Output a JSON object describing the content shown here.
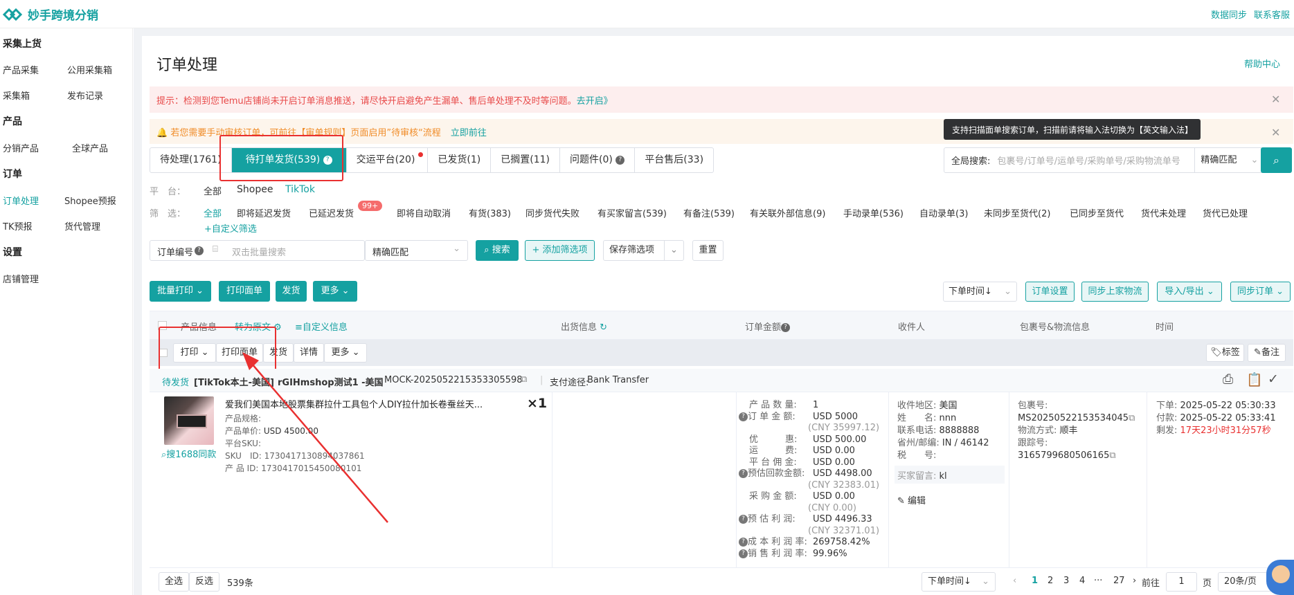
{
  "app": {
    "name": "妙手跨境分销",
    "top_links": [
      "数据同步",
      "联系客服"
    ]
  },
  "sidebar": {
    "sections": [
      {
        "title": "采集上货",
        "items": [
          "产品采集",
          "公用采集箱",
          "采集箱",
          "发布记录"
        ]
      },
      {
        "title": "产品",
        "items": [
          "分销产品",
          "全球产品"
        ]
      },
      {
        "title": "订单",
        "items": [
          "订单处理",
          "Shopee预报",
          "TK预报",
          "货代管理"
        ]
      },
      {
        "title": "设置",
        "items": [
          "店铺管理"
        ]
      }
    ],
    "active": "订单处理"
  },
  "page": {
    "title": "订单处理",
    "help": "帮助中心"
  },
  "alerts": {
    "temu": {
      "text": "提示：检测到您Temu店铺尚未开启订单消息推送，请尽快开启避免产生漏单、售后单处理不及时等问题。",
      "link": "去开启》"
    },
    "review": {
      "text": "若您需要手动审核订单，可前往【审单规则】页面启用”待审核“流程",
      "link": "立即前往"
    }
  },
  "tooltip": "支持扫描面单搜索订单，扫描前请将输入法切换为【英文输入法】",
  "tabs": [
    {
      "label": "待处理(1761)"
    },
    {
      "label": "待打单发货(539)",
      "active": true
    },
    {
      "label": "交运平台(20)"
    },
    {
      "label": "已发货(1)"
    },
    {
      "label": "已搁置(11)"
    },
    {
      "label": "问题件(0)"
    },
    {
      "label": "平台售后(33)"
    }
  ],
  "global_search": {
    "label": "全局搜索:",
    "placeholder": "包裹号/订单号/运单号/采购单号/采购物流单号",
    "mode": "精确匹配"
  },
  "platform_row": {
    "label": "平　台：",
    "options": [
      "全部",
      "Shopee",
      "TikTok"
    ]
  },
  "filter_row": {
    "label": "筛　选：",
    "options": [
      "全部",
      "即将延迟发货",
      "已延迟发货",
      "即将自动取消",
      "有货(383)",
      "同步货代失败",
      "有买家留言(539)",
      "有备注(539)",
      "有关联外部信息(9)",
      "手动录单(536)",
      "自动录单(3)",
      "未同步至货代(2)",
      "已同步至货代",
      "货代未处理",
      "货代已处理"
    ],
    "badge": "99+",
    "custom": "+自定义筛选"
  },
  "search_row": {
    "field_label": "订单编号",
    "placeholder": "双击批量搜索",
    "match": "精确匹配",
    "search": "搜索",
    "add_filter": "+ 添加筛选项",
    "save_filter": "保存筛选项",
    "reset": "重置"
  },
  "actions": {
    "batch_print": "批量打印",
    "print_label": "打印面单",
    "ship": "发货",
    "more": "更多",
    "sort": "下单时间↓",
    "order_settings": "订单设置",
    "sync_logistics": "同步上家物流",
    "import_export": "导入/导出",
    "sync_orders": "同步订单"
  },
  "table_headers": {
    "product": "产品信息",
    "convert": "转为原文",
    "custom_info": "自定义信息",
    "shipping": "出货信息",
    "amount": "订单金额",
    "recipient": "收件人",
    "package": "包裹号&物流信息",
    "time": "时间"
  },
  "batch_bar": {
    "print": "打印",
    "print_label": "打印面单",
    "ship": "发货",
    "detail": "详情",
    "more": "更多",
    "tag": "标签",
    "note": "备注"
  },
  "order": {
    "status": "待发货",
    "store": "[TikTok本土-美国]",
    "shop": "rGIHmshop测试1 -美国",
    "order_no": "MOCK-2025052215353305598",
    "payment_label": "支付途径:",
    "payment": "Bank Transfer",
    "product_title": "爱我们美国本地股票集群拉什工具包个人DIY拉什加长卷蚕丝天...",
    "qty": "×1",
    "spec_label": "产品规格:",
    "price_label": "产品单价:",
    "price": "USD 4500.00",
    "psku_label": "平台SKU:",
    "sku_label": "SKU　ID:",
    "sku": "1730417130894037861",
    "pid_label": "产 品 ID:",
    "pid": "1730417015450080101",
    "search_1688": "搜1688同款",
    "amounts": [
      {
        "k": "产 品 数 量:",
        "v": "1"
      },
      {
        "k": "订 单 金 额:",
        "v": "USD 5000",
        "sub": "(CNY 35997.12)",
        "q": true
      },
      {
        "k": "优　　　惠:",
        "v": "USD 500.00"
      },
      {
        "k": "运　　　费:",
        "v": "USD 0.00"
      },
      {
        "k": "平 台 佣 金:",
        "v": "USD 0.00"
      },
      {
        "k": "预估回款金额:",
        "v": "USD 4498.00",
        "sub": "(CNY 32383.01)",
        "q": true
      },
      {
        "k": "采 购 金 额:",
        "v": "USD 0.00",
        "sub": "(CNY 0.00)"
      },
      {
        "k": "预 估 利 润:",
        "v": "USD 4496.33",
        "sub": "(CNY 32371.01)",
        "q": true
      },
      {
        "k": "成 本 利 润 率:",
        "v": "269758.42%",
        "q": true
      },
      {
        "k": "销 售 利 润 率:",
        "v": "99.96%",
        "q": true
      }
    ],
    "recipient": [
      {
        "k": "收件地区:",
        "v": "美国"
      },
      {
        "k": "姓　　名:",
        "v": "nnn"
      },
      {
        "k": "联系电话:",
        "v": "8888888"
      },
      {
        "k": "省州/邮编:",
        "v": "IN / 46142"
      },
      {
        "k": "税　　号:",
        "v": ""
      }
    ],
    "buyer_msg_label": "买家留言:",
    "buyer_msg": "kl",
    "edit": "编辑",
    "package_label": "包裹号:",
    "package_no": "MS20250522153534045",
    "logistics_label": "物流方式:",
    "logistics": "顺丰",
    "tracking_label": "跟踪号:",
    "tracking": "3165799680506165",
    "times": [
      {
        "k": "下单:",
        "v": "2025-05-22 05:30:33"
      },
      {
        "k": "付款:",
        "v": "2025-05-22 05:33:41"
      },
      {
        "k": "剩发:",
        "v": "17天23小时31分57秒",
        "red": true
      }
    ]
  },
  "footer": {
    "select_all": "全选",
    "invert": "反选",
    "count": "539条",
    "sort": "下单时间↓",
    "pages": [
      "1",
      "2",
      "3",
      "4",
      "···",
      "27"
    ],
    "goto_label": "前往",
    "goto_value": "1",
    "page_unit": "页",
    "page_size": "20条/页"
  },
  "colors": {
    "primary": "#15a1a1",
    "danger": "#e93030",
    "warning": "#f08c28"
  }
}
